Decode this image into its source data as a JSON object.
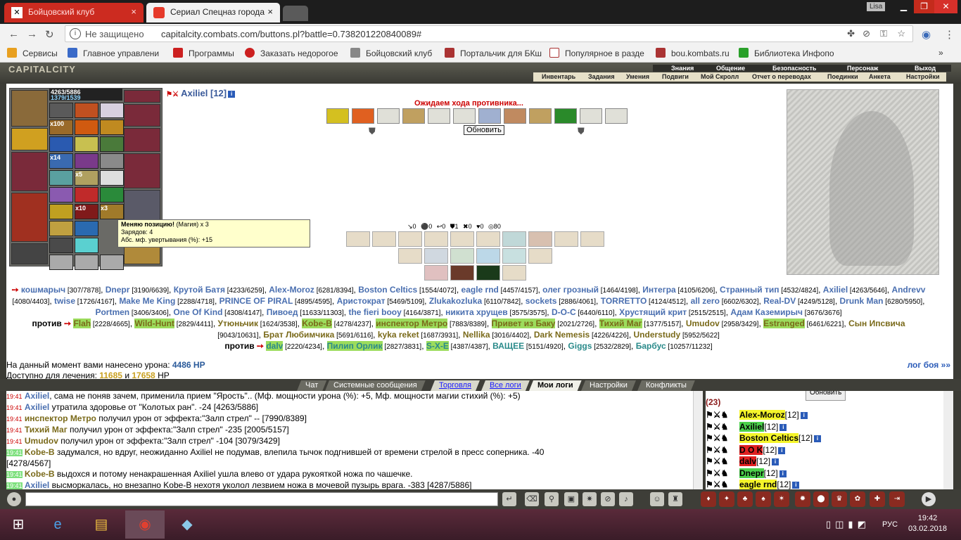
{
  "browser": {
    "tabs": [
      {
        "title": "Бойцовский клуб"
      },
      {
        "title": "Сериал Спецназ города"
      }
    ],
    "user_badge": "Lisa",
    "security_label": "Не защищено",
    "url": "capitalcity.combats.com/buttons.pl?battle=0.738201220840089#",
    "bookmarks": [
      {
        "label": "Сервисы",
        "color": "#e8a020"
      },
      {
        "label": "Главное управлени",
        "color": "#3a6ac8"
      },
      {
        "label": "Программы",
        "color": "#cc2020"
      },
      {
        "label": "Заказать недорогое",
        "color": "#cc2020"
      },
      {
        "label": "Бойцовский клуб",
        "color": "#888888"
      },
      {
        "label": "Портальчик для БКш",
        "color": "#aa3333"
      },
      {
        "label": "Популярное в разде",
        "color": "#aa3333"
      },
      {
        "label": "bou.kombats.ru",
        "color": "#aa3333"
      },
      {
        "label": "Библиотека Инфопо",
        "color": "#2aa02a"
      }
    ]
  },
  "game": {
    "logo": "CAPITALCITY",
    "top_menu": [
      "Знания",
      "Общение",
      "Безопасность",
      "Персонаж",
      "Выход"
    ],
    "sub_menu": [
      "Инвентарь",
      "Задания",
      "Умения",
      "Подвиги",
      "Мой Скролл",
      "Отчет о переводах",
      "Поединки",
      "Анкета",
      "Настройки"
    ],
    "player": {
      "name": "Axiliel [12]",
      "hp": "4263/5886",
      "mana": "1379/1539"
    },
    "inventory_counts": [
      "x100",
      "x14",
      "x10",
      "x3",
      "x5"
    ],
    "tooltip": {
      "title": "Меняю позицию!",
      "kind": "(Магия) x 3",
      "charges": "Зарядов: 4",
      "stat": "Абс. мф. увертывания (%): +15"
    },
    "waiting_text": "Ожидаем хода противника...",
    "refresh_label": "Обновить",
    "stats_line": "↘0  ⚫0  ↩0  ⛊1  ✖0  ♥0  ◎80",
    "team1_label": "",
    "vs_label": "против",
    "damage_text": "На данный момент вами нанесено урона:",
    "damage_value": "4486 HP",
    "heal_text": "Доступно для лечения:",
    "heal_value1": "11685",
    "heal_and": "и",
    "heal_value2": "17658",
    "heal_unit": "HP",
    "battle_log_link": "лог боя »»"
  },
  "teams": {
    "team1": [
      {
        "n": "кошмарыч",
        "v": "[307/7878]",
        "c": "bl"
      },
      {
        "n": "Dnepr",
        "v": "[3190/6639]",
        "c": "bl"
      },
      {
        "n": "Крутой Батя",
        "v": "[4233/6259]",
        "c": "bl"
      },
      {
        "n": "Alex-Moroz",
        "v": "[6281/8394]",
        "c": "bl"
      },
      {
        "n": "Boston Celtics",
        "v": "[1554/4072]",
        "c": "bl"
      },
      {
        "n": "eagle rnd",
        "v": "[4457/4157]",
        "c": "bl"
      },
      {
        "n": "олег грозный",
        "v": "[1464/4198]",
        "c": "bl"
      },
      {
        "n": "Интегра",
        "v": "[4105/6206]",
        "c": "bl"
      },
      {
        "n": "Странный тип",
        "v": "[4532/4824]",
        "c": "bl"
      },
      {
        "n": "Axiliel",
        "v": "[4263/5646]",
        "c": "bl"
      },
      {
        "n": "Andrevv",
        "v": "[4080/4403]",
        "c": "bl"
      },
      {
        "n": "twise",
        "v": "[1726/4167]",
        "c": "bl"
      },
      {
        "n": "Make Me King",
        "v": "[2288/4718]",
        "c": "bl"
      },
      {
        "n": "PRINCE OF PIRAL",
        "v": "[4895/4595]",
        "c": "bl"
      },
      {
        "n": "Аристократ",
        "v": "[5469/5109]",
        "c": "bl"
      },
      {
        "n": "Zlukakozluka",
        "v": "[6110/7842]",
        "c": "bl"
      },
      {
        "n": "sockets",
        "v": "[2886/4061]",
        "c": "bl"
      },
      {
        "n": "TORRETTO",
        "v": "[4124/4512]",
        "c": "bl"
      },
      {
        "n": "all zero",
        "v": "[6602/6302]",
        "c": "bl"
      },
      {
        "n": "Real-DV",
        "v": "[4249/5128]",
        "c": "bl"
      },
      {
        "n": "Drunk Man",
        "v": "[6280/5950]",
        "c": "bl"
      },
      {
        "n": "Portmen",
        "v": "[3406/3406]",
        "c": "bl"
      },
      {
        "n": "One Of Kind",
        "v": "[4308/4147]",
        "c": "bl"
      },
      {
        "n": "Пивоед",
        "v": "[11633/11303]",
        "c": "bl"
      },
      {
        "n": "the fieri booy",
        "v": "[4164/3871]",
        "c": "bl"
      },
      {
        "n": "никита хрущев",
        "v": "[3575/3575]",
        "c": "bl"
      },
      {
        "n": "D-O-C",
        "v": "[6440/6110]",
        "c": "bl"
      },
      {
        "n": "Хрустящий крит",
        "v": "[2515/2515]",
        "c": "bl"
      },
      {
        "n": "Адам Каземирыч",
        "v": "[3676/3676]",
        "c": "bl"
      }
    ],
    "team2": [
      {
        "n": "Flah",
        "v": "[2228/4665]",
        "c": "hl"
      },
      {
        "n": "Wild-Hunt",
        "v": "[2829/4411]",
        "c": "hl"
      },
      {
        "n": "Утюньчик",
        "v": "[1624/3538]",
        "c": "gr"
      },
      {
        "n": "Kobe-B",
        "v": "[4278/4237]",
        "c": "hl"
      },
      {
        "n": "инспектор Метро",
        "v": "[7883/8389]",
        "c": "hl"
      },
      {
        "n": "Привет из Баку",
        "v": "[2021/2726]",
        "c": "hl"
      },
      {
        "n": "Тихий Маг",
        "v": "[1377/5157]",
        "c": "hl"
      },
      {
        "n": "Umudov",
        "v": "[2958/3429]",
        "c": "gr"
      },
      {
        "n": "Estranged",
        "v": "[6461/6221]",
        "c": "hl"
      },
      {
        "n": "Сын Ипсвича",
        "v": "[9043/10631]",
        "c": "gr"
      },
      {
        "n": "Брат Любимчика",
        "v": "[5691/6116]",
        "c": "gr"
      },
      {
        "n": "kyka reket",
        "v": "[1687/3931]",
        "c": "gr"
      },
      {
        "n": "Nellika",
        "v": "[3016/4402]",
        "c": "gr"
      },
      {
        "n": "Dark Nemesis",
        "v": "[4226/4226]",
        "c": "gr"
      },
      {
        "n": "Understudy",
        "v": "[5952/5622]",
        "c": "gr"
      }
    ],
    "team3": [
      {
        "n": "dalv",
        "v": "[2220/4234]",
        "c": "hlb"
      },
      {
        "n": "Пилип Орлик",
        "v": "[2827/3831]",
        "c": "hlb"
      },
      {
        "n": "S-X-E",
        "v": "[4387/4387]",
        "c": "hlb"
      },
      {
        "n": "ВАЩЕЕ",
        "v": "[5151/4920]",
        "c": "tl"
      },
      {
        "n": "Giggs",
        "v": "[2532/2829]",
        "c": "tl"
      },
      {
        "n": "Барбус",
        "v": "[10257/11232]",
        "c": "tl"
      }
    ]
  },
  "chat": {
    "tabs": [
      "Чат",
      "Системные сообщения",
      "Торговля",
      "Все логи",
      "Мои логи",
      "Настройки",
      "Конфликты"
    ],
    "lines": [
      {
        "t": "19:41",
        "n": "Axiliel",
        "nc": "#4a6fb0",
        "x": ", сама не поняв зачем, применила прием \"Ярость\".. (Мф. мощности урона (%): +5, Мф. мощности магии стихий (%): +5)"
      },
      {
        "t": "19:41",
        "n": "Axiliel",
        "nc": "#4a6fb0",
        "x": " утратила здоровье от \"Колотых ран\". -24 [4263/5886]"
      },
      {
        "t": "19:41",
        "n": "инспектор Метро",
        "nc": "#7a6a1a",
        "x": " получил урон от эффекта:\"Залп стрел\" -- [7990/8389]"
      },
      {
        "t": "19:41",
        "n": "Тихий Маг",
        "nc": "#7a6a1a",
        "x": " получил урон от эффекта:\"Залп стрел\" -235 [2005/5157]"
      },
      {
        "t": "19:41",
        "n": "Umudov",
        "nc": "#7a6a1a",
        "x": " получил урон от эффекта:\"Залп стрел\" -104 [3079/3429]"
      },
      {
        "t": "19:41",
        "n": "Kobe-B",
        "nc": "#7a6a1a",
        "x": " задумался, но вдруг, неожиданно Axiliel не подумав, влепила тычок подгнившей от времени стрелой в пресс соперника. -40"
      },
      {
        "t": "",
        "n": "",
        "nc": "#000",
        "x": "[4278/4567]"
      },
      {
        "t": "19:41",
        "n": "Kobe-B",
        "nc": "#7a6a1a",
        "x": " выдохся и потому ненакрашенная Axiliel ушла влево от удара рукояткой ножа по чашечке."
      },
      {
        "t": "19:41",
        "n": "Axiliel",
        "nc": "#4a6fb0",
        "x": " высморкалась, но внезапно Kobe-B нехотя уколол лезвием ножа в мочевой пузырь врага. -383 [4287/5886]"
      }
    ],
    "online_refresh": "Обновить",
    "online_count": "(23)",
    "online": [
      {
        "n": "Alex-Moroz",
        "lv": "[12]",
        "h": "hy"
      },
      {
        "n": "Axiliel",
        "lv": "[12]",
        "h": "hg"
      },
      {
        "n": "Boston Celtics",
        "lv": "[12]",
        "h": "hy"
      },
      {
        "n": "D O K",
        "lv": "[12]",
        "h": "hr"
      },
      {
        "n": "dalv",
        "lv": "[12]",
        "h": "hr"
      },
      {
        "n": "Dnepr",
        "lv": "[12]",
        "h": "hg"
      },
      {
        "n": "eagle rnd",
        "lv": "[12]",
        "h": "hy"
      }
    ]
  },
  "taskbar": {
    "lang": "РУС",
    "time": "19:42",
    "date": "03.02.2018"
  }
}
